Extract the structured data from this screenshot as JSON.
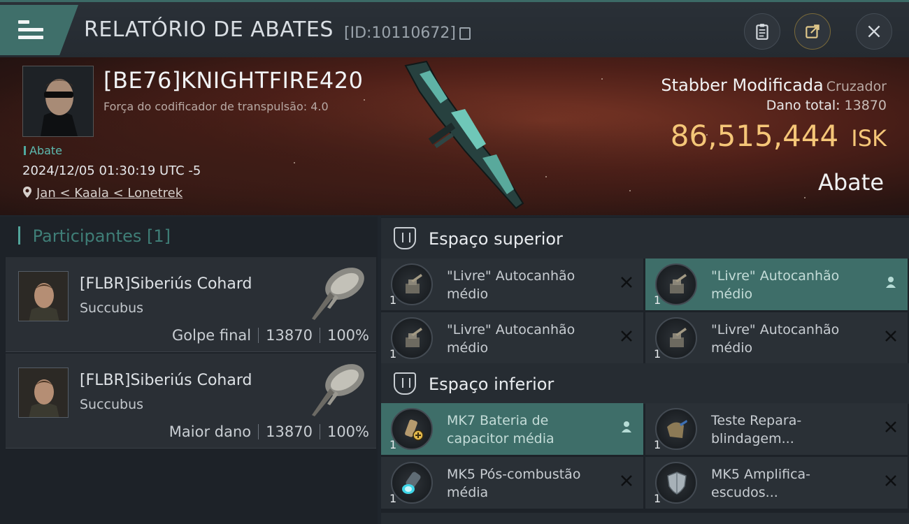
{
  "header": {
    "title": "RELATÓRIO DE ABATES",
    "id_label": "[ID:10110672]"
  },
  "victim": {
    "name": "[BE76]KNIGHTFIRE420",
    "attribute": "Força do codificador de transpulsão: 4.0",
    "kill_type": "Abate",
    "datetime": "2024/12/05 01:30:19 UTC -5",
    "location": "Jan < Kaala < Lonetrek"
  },
  "ship": {
    "name": "Stabber Modificada",
    "class": "Cruzador",
    "damage_label": "Dano total:",
    "damage_value": "13870",
    "isk_value": "86,515,444",
    "isk_unit": "ISK",
    "outcome": "Abate"
  },
  "participants": {
    "label": "Participantes",
    "count": "[1]",
    "list": [
      {
        "name": "[FLBR]Siberiús Cohard",
        "ship": "Succubus",
        "role": "Golpe final",
        "damage": "13870",
        "percent": "100%"
      },
      {
        "name": "[FLBR]Siberiús Cohard",
        "ship": "Succubus",
        "role": "Maior dano",
        "damage": "13870",
        "percent": "100%"
      }
    ]
  },
  "fitting": {
    "high": {
      "title": "Espaço superior",
      "items": [
        {
          "qty": "1",
          "name": "\"Livre\" Autocanhão médio",
          "state": "destroyed",
          "icon": "autocannon-icon"
        },
        {
          "qty": "1",
          "name": "\"Livre\" Autocanhão médio",
          "state": "dropped",
          "icon": "autocannon-icon"
        },
        {
          "qty": "1",
          "name": "\"Livre\" Autocanhão médio",
          "state": "destroyed",
          "icon": "autocannon-icon"
        },
        {
          "qty": "1",
          "name": "\"Livre\" Autocanhão médio",
          "state": "destroyed",
          "icon": "autocannon-icon"
        }
      ]
    },
    "low": {
      "title": "Espaço inferior",
      "items": [
        {
          "qty": "1",
          "name": "MK7 Bateria de capacitor média",
          "state": "dropped",
          "icon": "capacitor-battery-icon"
        },
        {
          "qty": "1",
          "name": "Teste Repara-blindagem...",
          "state": "destroyed",
          "icon": "armor-repairer-icon"
        },
        {
          "qty": "1",
          "name": "MK5 Pós-combustão média",
          "state": "destroyed",
          "icon": "afterburner-icon"
        },
        {
          "qty": "1",
          "name": "MK5 Amplifica-escudos...",
          "state": "destroyed",
          "icon": "shield-amplifier-icon"
        }
      ]
    }
  },
  "colors": {
    "accent_teal": "#3e6e69",
    "isk_gold": "#f5c678",
    "banner_red": "#7a3626"
  }
}
